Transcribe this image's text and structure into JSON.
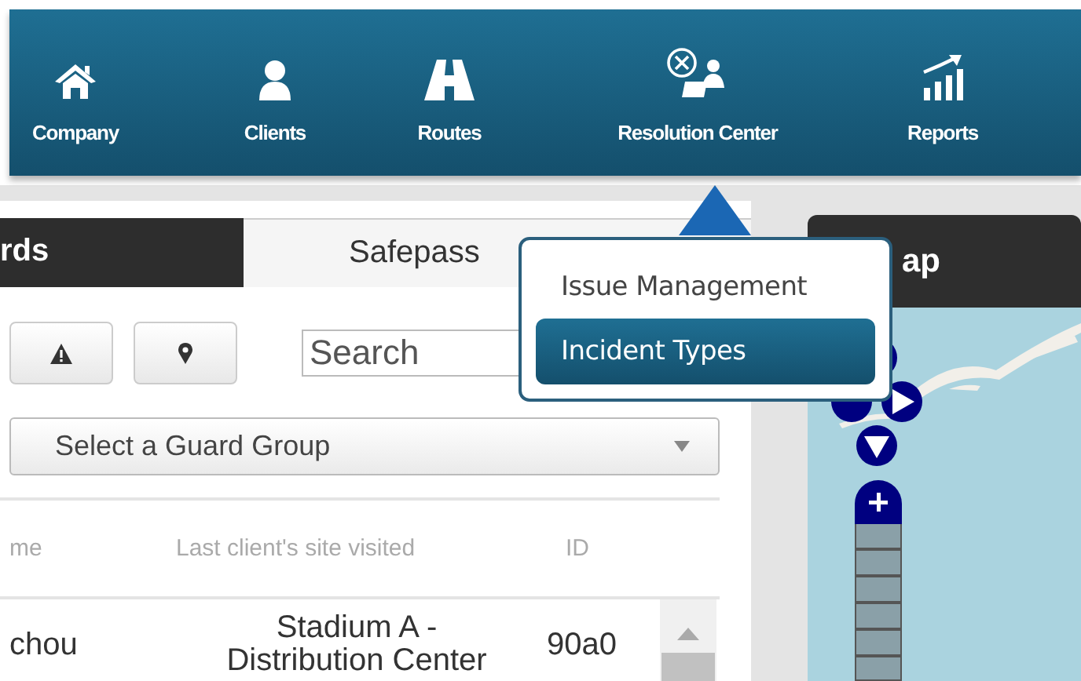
{
  "nav": {
    "items": [
      {
        "label": "Company"
      },
      {
        "label": "Clients"
      },
      {
        "label": "Routes"
      },
      {
        "label": "Resolution Center"
      },
      {
        "label": "Reports"
      }
    ]
  },
  "left_panel": {
    "tabs": [
      {
        "label": "rds",
        "selected": true
      },
      {
        "label": "Safepass",
        "selected": false
      }
    ],
    "search": {
      "placeholder": "Search"
    },
    "guard_group": {
      "value": "Select a Guard Group"
    },
    "table": {
      "columns": [
        "me",
        "Last client's site visited",
        "ID"
      ],
      "rows": [
        [
          "chou",
          "Stadium A - Distribution Center",
          "90a0"
        ]
      ]
    }
  },
  "dropdown_menu": {
    "items": [
      {
        "label": "Issue Management",
        "selected": false
      },
      {
        "label": "Incident Types",
        "selected": true
      }
    ]
  },
  "map_panel": {
    "title": "ap"
  }
}
